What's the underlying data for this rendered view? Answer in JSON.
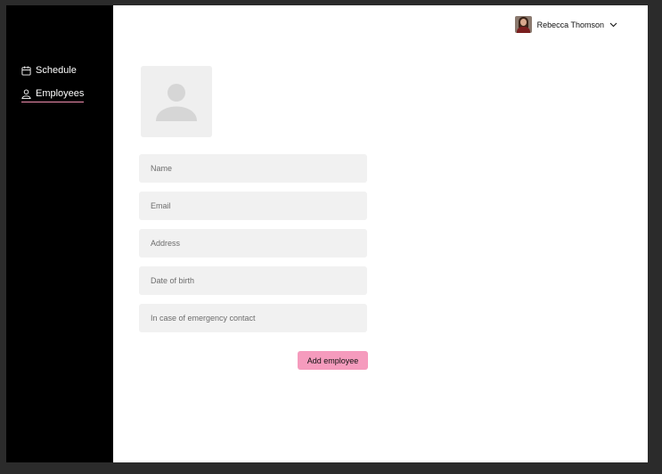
{
  "sidebar": {
    "items": [
      {
        "label": "Schedule",
        "icon": "calendar-icon"
      },
      {
        "label": "Employees",
        "icon": "user-icon",
        "active": true
      }
    ]
  },
  "header": {
    "user_name": "Rebecca Thomson"
  },
  "form": {
    "photo_icon": "person-placeholder-icon",
    "fields": {
      "name": {
        "placeholder": "Name",
        "value": ""
      },
      "email": {
        "placeholder": "Email",
        "value": ""
      },
      "address": {
        "placeholder": "Address",
        "value": ""
      },
      "dob": {
        "placeholder": "Date of birth",
        "value": ""
      },
      "emergency": {
        "placeholder": "In case of emergency contact",
        "value": ""
      }
    },
    "submit_label": "Add employee"
  },
  "colors": {
    "sidebar_bg": "#000000",
    "accent": "#f59bbd",
    "field_bg": "#f1f1f1"
  }
}
